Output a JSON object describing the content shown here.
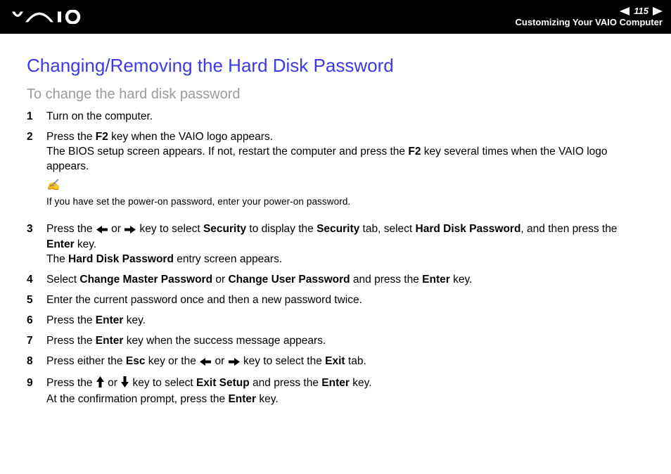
{
  "header": {
    "page_number": "115",
    "breadcrumb": "Customizing Your VAIO Computer"
  },
  "title": "Changing/Removing the Hard Disk Password",
  "subtitle": "To change the hard disk password",
  "steps": {
    "s1": {
      "num": "1",
      "t1": "Turn on the computer."
    },
    "s2": {
      "num": "2",
      "t1": "Press the ",
      "b1": "F2",
      "t2": " key when the VAIO logo appears.",
      "t3": "The BIOS setup screen appears. If not, restart the computer and press the ",
      "b2": "F2",
      "t4": " key several times when the VAIO logo appears."
    },
    "note": {
      "icon": "✍",
      "text": "If you have set the power-on password, enter your power-on password."
    },
    "s3": {
      "num": "3",
      "t1": "Press the ",
      "t2": " or ",
      "t3": " key to select ",
      "b1": "Security",
      "t4": " to display the ",
      "b2": "Security",
      "t5": " tab, select ",
      "b3": "Hard Disk Password",
      "t6": ", and then press the ",
      "b4": "Enter",
      "t7": " key.",
      "t8": "The ",
      "b5": "Hard Disk Password",
      "t9": " entry screen appears."
    },
    "s4": {
      "num": "4",
      "t1": "Select ",
      "b1": "Change Master Password",
      "t2": " or ",
      "b2": "Change User Password",
      "t3": " and press the ",
      "b3": "Enter",
      "t4": " key."
    },
    "s5": {
      "num": "5",
      "t1": "Enter the current password once and then a new password twice."
    },
    "s6": {
      "num": "6",
      "t1": "Press the ",
      "b1": "Enter",
      "t2": " key."
    },
    "s7": {
      "num": "7",
      "t1": "Press the ",
      "b1": "Enter",
      "t2": " key when the success message appears."
    },
    "s8": {
      "num": "8",
      "t1": "Press either the ",
      "b1": "Esc",
      "t2": " key or the ",
      "t3": " or ",
      "t4": " key to select the ",
      "b2": "Exit",
      "t5": " tab."
    },
    "s9": {
      "num": "9",
      "t1": "Press the ",
      "t2": " or ",
      "t3": " key to select ",
      "b1": "Exit Setup",
      "t4": " and press the ",
      "b2": "Enter",
      "t5": " key.",
      "t6": "At the confirmation prompt, press the ",
      "b3": "Enter",
      "t7": " key."
    }
  }
}
